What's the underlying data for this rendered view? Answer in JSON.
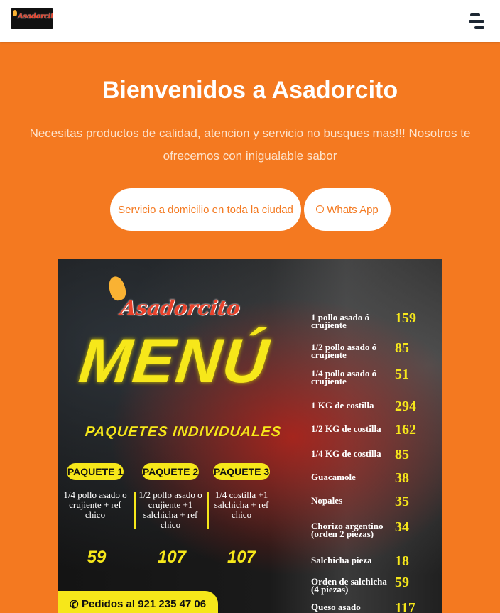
{
  "navbar": {
    "logo_text": "Asadorcito",
    "menu_icon": "hamburger-menu-icon"
  },
  "hero": {
    "title": "Bienvenidos a Asadorcito",
    "subtitle": "Necesitas productos de calidad, atencion y servicio no busques mas!!! Nosotros te ofrecemos con inigualable sabor",
    "buttons": {
      "delivery_label": "Servicio a domicilio en toda la ciudad",
      "whatsapp_label": "Whats App"
    }
  },
  "menu_image": {
    "brand": "Asadorcito",
    "menu_title": "MENÚ",
    "packages_title": "PAQUETES INDIVIDUALES",
    "packages": [
      {
        "label": "PAQUETE 1",
        "description": "1/4 pollo asado o crujiente + ref chico",
        "price": "59"
      },
      {
        "label": "PAQUETE 2",
        "description": "1/2 pollo asado o crujiente +1 salchicha + ref chico",
        "price": "107"
      },
      {
        "label": "PAQUETE 3",
        "description": "1/4 costilla +1 salchicha + ref chico",
        "price": "107"
      }
    ],
    "orders": "Pedidos al 921 235 47 06",
    "items": [
      {
        "name": "1 pollo asado ó crujiente",
        "price": "159"
      },
      {
        "name": "1/2 pollo asado ó crujiente",
        "price": "85"
      },
      {
        "name": "1/4 pollo asado ó crujiente",
        "price": "51"
      },
      {
        "name": "1 KG de costilla",
        "price": "294"
      },
      {
        "name": "1/2 KG de costilla",
        "price": "162"
      },
      {
        "name": "1/4 KG de costilla",
        "price": "85"
      },
      {
        "name": "Guacamole",
        "price": "38"
      },
      {
        "name": "Nopales",
        "price": "35"
      },
      {
        "name": "Chorizo argentino (orden 2 piezas)",
        "price": "34"
      },
      {
        "name": "Salchicha pieza",
        "price": "18"
      },
      {
        "name": "Orden de salchicha (4 piezas)",
        "price": "59"
      },
      {
        "name": "Queso asado",
        "price": "117"
      }
    ]
  },
  "colors": {
    "brand_orange": "#f47920",
    "menu_yellow": "#f6e71a",
    "logo_red": "#e9422b"
  }
}
